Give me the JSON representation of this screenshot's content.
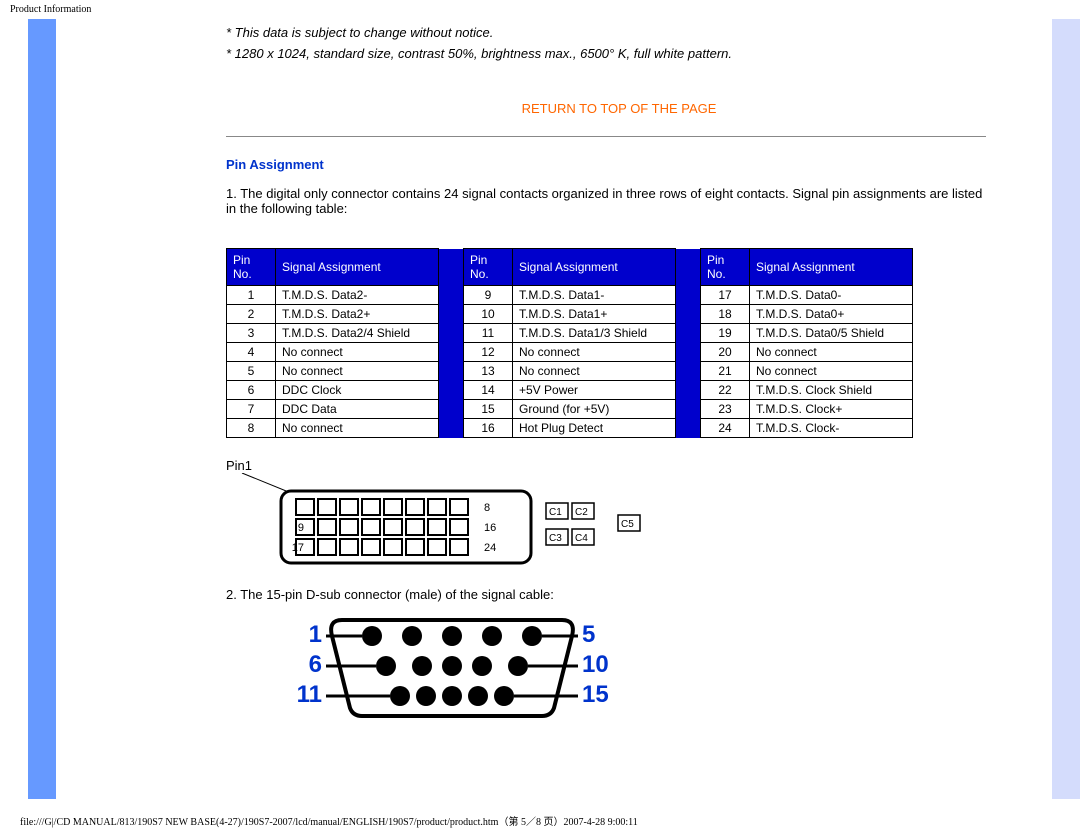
{
  "header": "Product Information",
  "notes": {
    "note1": "* This data is subject to change without notice.",
    "note2": "* 1280 x 1024, standard size, contrast 50%, brightness max., 6500° K, full white pattern."
  },
  "return_link": "RETURN TO TOP OF THE PAGE",
  "section_title": "Pin Assignment",
  "intro_text": "1. The digital only connector contains 24 signal contacts organized in three rows of eight contacts. Signal pin assignments are listed in the following table:",
  "table_headers": {
    "pin_no": "Pin No.",
    "signal": "Signal Assignment"
  },
  "tables": [
    [
      {
        "pin": "1",
        "sig": "T.M.D.S. Data2-"
      },
      {
        "pin": "2",
        "sig": "T.M.D.S. Data2+"
      },
      {
        "pin": "3",
        "sig": "T.M.D.S. Data2/4 Shield"
      },
      {
        "pin": "4",
        "sig": "No connect"
      },
      {
        "pin": "5",
        "sig": "No connect"
      },
      {
        "pin": "6",
        "sig": "DDC Clock"
      },
      {
        "pin": "7",
        "sig": "DDC Data"
      },
      {
        "pin": "8",
        "sig": "No connect"
      }
    ],
    [
      {
        "pin": "9",
        "sig": "T.M.D.S. Data1-"
      },
      {
        "pin": "10",
        "sig": "T.M.D.S. Data1+"
      },
      {
        "pin": "11",
        "sig": "T.M.D.S. Data1/3 Shield"
      },
      {
        "pin": "12",
        "sig": "No connect"
      },
      {
        "pin": "13",
        "sig": "No connect"
      },
      {
        "pin": "14",
        "sig": "+5V Power"
      },
      {
        "pin": "15",
        "sig": "Ground (for +5V)"
      },
      {
        "pin": "16",
        "sig": "Hot Plug Detect"
      }
    ],
    [
      {
        "pin": "17",
        "sig": "T.M.D.S. Data0-"
      },
      {
        "pin": "18",
        "sig": "T.M.D.S. Data0+"
      },
      {
        "pin": "19",
        "sig": "T.M.D.S. Data0/5 Shield"
      },
      {
        "pin": "20",
        "sig": "No connect"
      },
      {
        "pin": "21",
        "sig": "No connect"
      },
      {
        "pin": "22",
        "sig": "T.M.D.S. Clock Shield"
      },
      {
        "pin": "23",
        "sig": "T.M.D.S. Clock+"
      },
      {
        "pin": "24",
        "sig": "T.M.D.S. Clock-"
      }
    ]
  ],
  "pin1_label": "Pin1",
  "dvi_labels": {
    "r1end": "8",
    "r2start": "9",
    "r2end": "16",
    "r3start": "17",
    "r3end": "24",
    "c1": "C1",
    "c2": "C2",
    "c3": "C3",
    "c4": "C4",
    "c5": "C5"
  },
  "sub_text": "2. The 15-pin D-sub connector (male) of the signal cable:",
  "dsub_labels": {
    "l1": "1",
    "l2": "6",
    "l3": "11",
    "r1": "5",
    "r2": "10",
    "r3": "15"
  },
  "footer": "file:///G|/CD MANUAL/813/190S7 NEW BASE(4-27)/190S7-2007/lcd/manual/ENGLISH/190S7/product/product.htm（第 5／8 页）2007-4-28 9:00:11"
}
